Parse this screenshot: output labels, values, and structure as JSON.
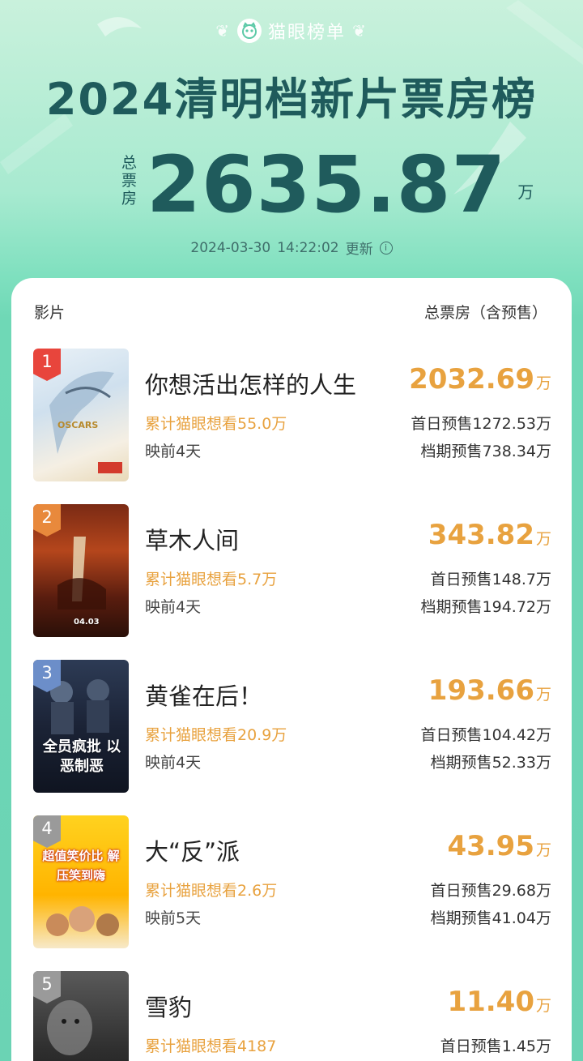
{
  "brand": "猫眼榜单",
  "title": "2024清明档新片票房榜",
  "total": {
    "label_chars": [
      "总",
      "票",
      "房"
    ],
    "value": "2635.87",
    "unit": "万"
  },
  "updated": {
    "date": "2024-03-30",
    "time": "14:22:02",
    "label": "更新"
  },
  "list_header": {
    "left": "影片",
    "right": "总票房（含预售）"
  },
  "movies": [
    {
      "rank": "1",
      "name": "你想活出怎样的人生",
      "want": "累计猫眼想看55.0万",
      "days": "映前4天",
      "gross": "2032.69",
      "unit": "万",
      "presale_first": "首日预售1272.53万",
      "presale_period": "档期预售738.34万",
      "rank_color": "#e8453c",
      "poster_text": "OSCARS"
    },
    {
      "rank": "2",
      "name": "草木人间",
      "want": "累计猫眼想看5.7万",
      "days": "映前4天",
      "gross": "343.82",
      "unit": "万",
      "presale_first": "首日预售148.7万",
      "presale_period": "档期预售194.72万",
      "rank_color": "#e8893c",
      "poster_text": "04.03"
    },
    {
      "rank": "3",
      "name": "黄雀在后！",
      "want": "累计猫眼想看20.9万",
      "days": "映前4天",
      "gross": "193.66",
      "unit": "万",
      "presale_first": "首日预售104.42万",
      "presale_period": "档期预售52.33万",
      "rank_color": "#6c8ec9",
      "poster_text": "全员疯批 以恶制恶"
    },
    {
      "rank": "4",
      "name": "大“反”派",
      "want": "累计猫眼想看2.6万",
      "days": "映前5天",
      "gross": "43.95",
      "unit": "万",
      "presale_first": "首日预售29.68万",
      "presale_period": "档期预售41.04万",
      "rank_color": "#9a9a9a",
      "poster_text": "超值笑价比 解压笑到嗨"
    },
    {
      "rank": "5",
      "name": "雪豹",
      "want": "累计猫眼想看4187",
      "days": "",
      "gross": "11.40",
      "unit": "万",
      "presale_first": "首日预售1.45万",
      "presale_period": "",
      "rank_color": "#9a9a9a",
      "poster_text": ""
    }
  ]
}
